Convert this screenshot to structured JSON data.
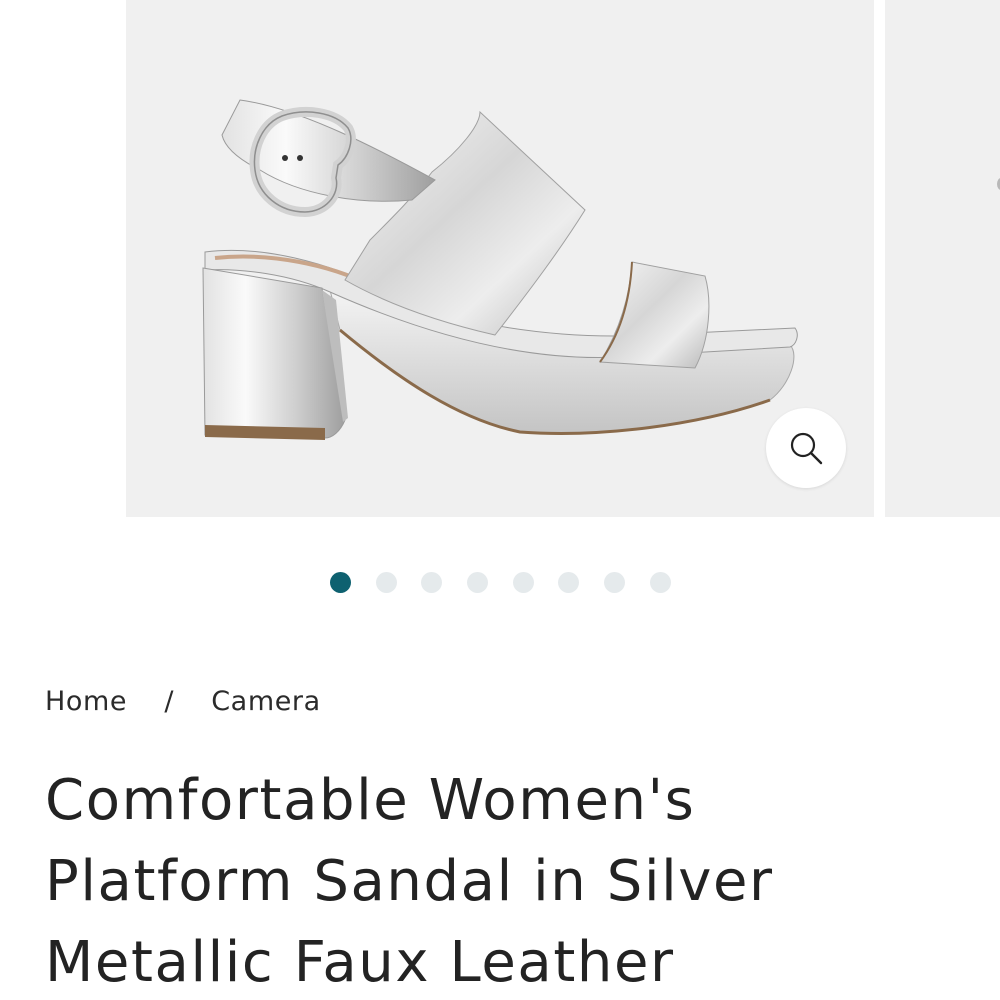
{
  "gallery": {
    "image_alt": "Silver metallic platform sandal with buckle slingback",
    "zoom_icon": "magnifier-icon",
    "dots_total": 8,
    "active_dot": 1
  },
  "breadcrumb": {
    "home": "Home",
    "separator": "/",
    "current": "Camera"
  },
  "product": {
    "title": "Comfortable Women's Platform Sandal in Silver Metallic Faux Leather"
  },
  "colors": {
    "accent": "#0e6170",
    "dot_inactive": "#e5eaec",
    "image_bg": "#f0f0f0"
  }
}
